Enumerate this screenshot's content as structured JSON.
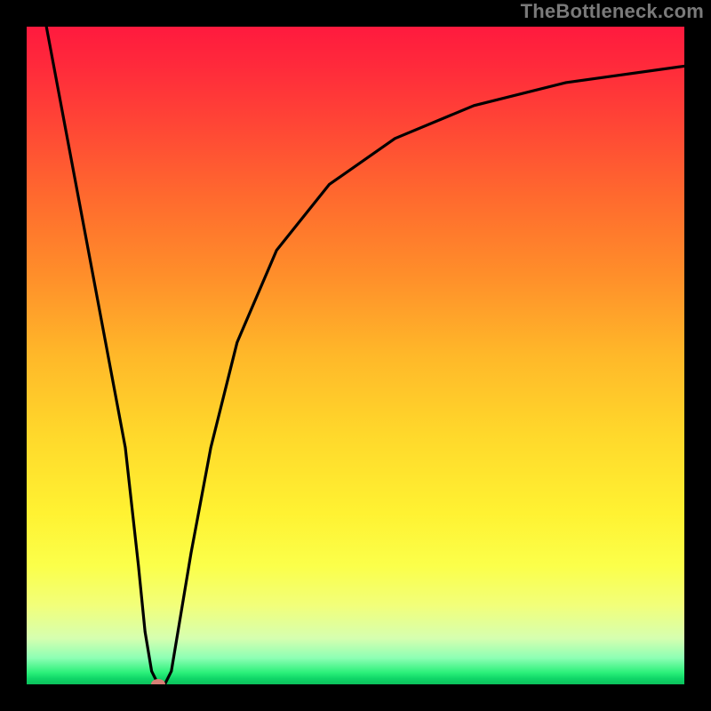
{
  "watermark": "TheBottleneck.com",
  "chart_data": {
    "type": "line",
    "title": "",
    "xlabel": "",
    "ylabel": "",
    "xlim": [
      0,
      100
    ],
    "ylim": [
      0,
      100
    ],
    "grid": false,
    "legend": false,
    "gradient_stops": [
      {
        "pos": 0,
        "color": "#ff1a3e"
      },
      {
        "pos": 14,
        "color": "#ff4336"
      },
      {
        "pos": 38,
        "color": "#ff8f2a"
      },
      {
        "pos": 62,
        "color": "#ffd82b"
      },
      {
        "pos": 82,
        "color": "#fbff4a"
      },
      {
        "pos": 93,
        "color": "#d6ffb0"
      },
      {
        "pos": 98,
        "color": "#2cf07a"
      },
      {
        "pos": 100,
        "color": "#0cc05c"
      }
    ],
    "series": [
      {
        "name": "bottleneck-curve",
        "x": [
          3,
          6,
          9,
          12,
          15,
          17,
          18,
          19,
          20,
          21,
          22,
          23,
          25,
          28,
          32,
          38,
          46,
          56,
          68,
          82,
          100
        ],
        "y": [
          100,
          84,
          68,
          52,
          36,
          18,
          8,
          2,
          0,
          0,
          2,
          8,
          20,
          36,
          52,
          66,
          76,
          83,
          88,
          91.5,
          94
        ]
      }
    ],
    "markers": [
      {
        "name": "optimal-point",
        "x": 20,
        "y": 0,
        "color": "#d77f75"
      }
    ]
  }
}
